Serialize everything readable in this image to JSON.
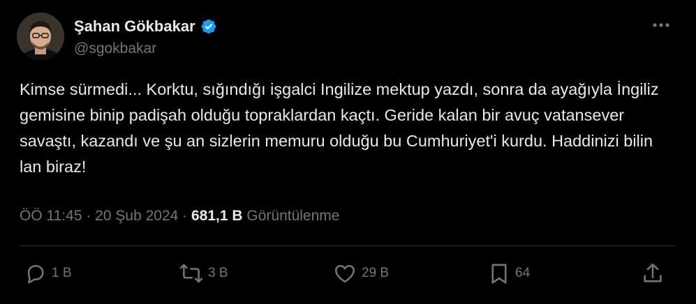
{
  "author": {
    "display_name": "Şahan Gökbakar",
    "handle": "@sgokbakar",
    "verified": true,
    "avatar": "profile-photo"
  },
  "tweet": {
    "text": "Kimse sürmedi... Korktu, sığındığı işgalci Ingilize mektup yazdı, sonra da ayağıyla İngiliz gemisine binip padişah olduğu topraklardan kaçtı. Geride kalan bir avuç vatansever savaştı, kazandı ve şu an sizlerin memuru olduğu bu Cumhuriyet'i kurdu. Haddinizi bilin lan biraz!",
    "time": "ÖÖ 11:45",
    "separator": "·",
    "date": "20 Şub 2024",
    "views_count": "681,1 B",
    "views_label": "Görüntülenme"
  },
  "actions": {
    "replies": "1 B",
    "retweets": "3 B",
    "likes": "29 B",
    "bookmarks": "64"
  },
  "icons": {
    "more": "more-horizontal-icon",
    "verified": "verified-badge-icon",
    "reply": "reply-icon",
    "retweet": "retweet-icon",
    "like": "heart-icon",
    "bookmark": "bookmark-icon",
    "share": "share-icon"
  },
  "colors": {
    "background": "#000000",
    "text": "#e7e9ea",
    "secondary": "#71767b",
    "verified": "#1d9bf0",
    "divider": "#2f3336"
  }
}
